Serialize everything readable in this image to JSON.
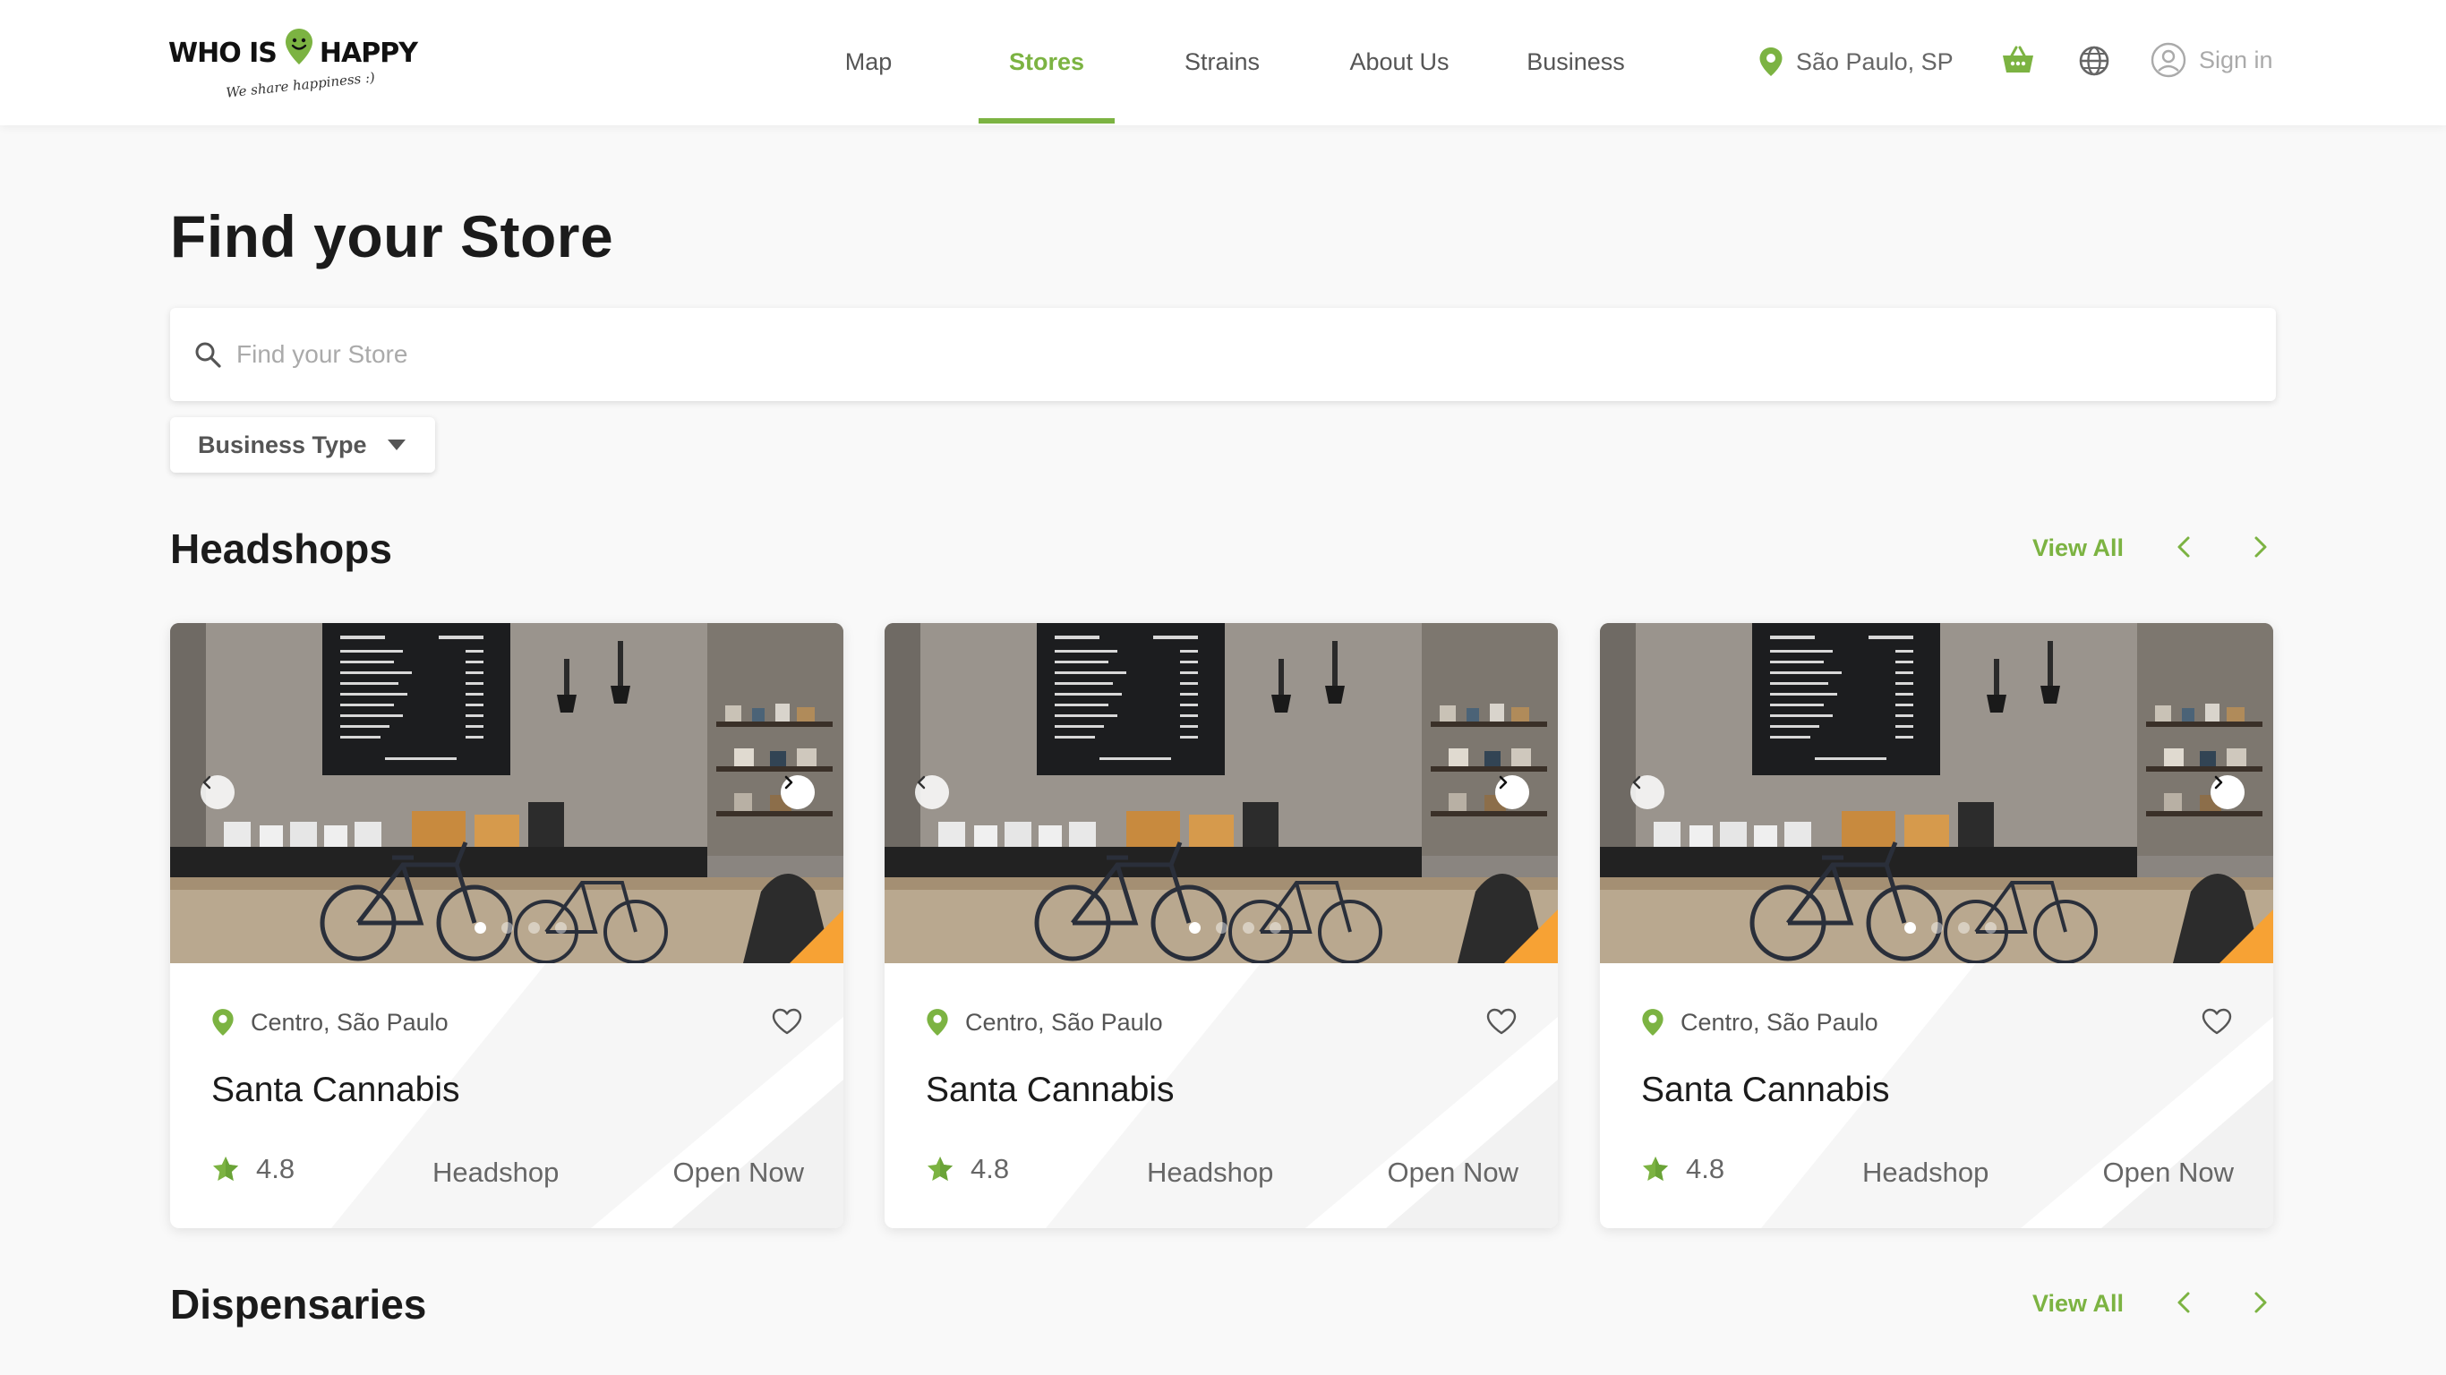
{
  "brand": {
    "name_part1": "WHO IS",
    "name_part2": "HAPPY",
    "tagline": "We share happiness :)",
    "accent_color": "#7cb342",
    "highlight_color": "#f7a234"
  },
  "nav": {
    "items": [
      {
        "label": "Map",
        "active": false
      },
      {
        "label": "Stores",
        "active": true
      },
      {
        "label": "Strains",
        "active": false
      },
      {
        "label": "About Us",
        "active": false
      },
      {
        "label": "Business",
        "active": false
      }
    ]
  },
  "header": {
    "location": "São Paulo, SP",
    "location_icon": "map-pin-icon",
    "basket_icon": "basket-icon",
    "language_icon": "globe-icon",
    "sign_in": "Sign in"
  },
  "page": {
    "title": "Find your Store"
  },
  "search": {
    "placeholder": "Find your Store",
    "value": ""
  },
  "filter": {
    "label": "Business Type"
  },
  "sections": [
    {
      "title": "Headshops",
      "view_all": "View All",
      "cards": [
        {
          "location": "Centro, São Paulo",
          "name": "Santa Cannabis",
          "rating": "4.8",
          "type": "Headshop",
          "status": "Open Now",
          "favorited": false
        },
        {
          "location": "Centro, São Paulo",
          "name": "Santa Cannabis",
          "rating": "4.8",
          "type": "Headshop",
          "status": "Open Now",
          "favorited": false
        },
        {
          "location": "Centro, São Paulo",
          "name": "Santa Cannabis",
          "rating": "4.8",
          "type": "Headshop",
          "status": "Open Now",
          "favorited": false
        }
      ]
    },
    {
      "title": "Dispensaries",
      "view_all": "View All",
      "cards": []
    }
  ]
}
